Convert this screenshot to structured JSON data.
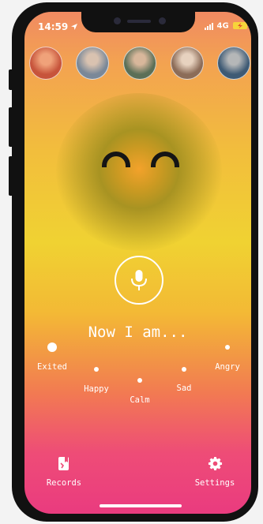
{
  "status_bar": {
    "time": "14:59",
    "network": "4G"
  },
  "friends": [
    {
      "name": "friend-1",
      "colors": [
        "#c7543b",
        "#f0a27a"
      ]
    },
    {
      "name": "friend-2",
      "colors": [
        "#7a8898",
        "#d9c2b0"
      ]
    },
    {
      "name": "friend-3",
      "colors": [
        "#5b6f57",
        "#d8b79b"
      ]
    },
    {
      "name": "friend-4",
      "colors": [
        "#8c6c58",
        "#e7d2bf"
      ]
    },
    {
      "name": "friend-5",
      "colors": [
        "#3e5a74",
        "#b5b7b8"
      ]
    }
  ],
  "prompt": "Now I am...",
  "moods": [
    {
      "label": "Exited",
      "selected": true
    },
    {
      "label": "Happy",
      "selected": false
    },
    {
      "label": "Calm",
      "selected": false
    },
    {
      "label": "Sad",
      "selected": false
    },
    {
      "label": "Angry",
      "selected": false
    }
  ],
  "nav": {
    "records": "Records",
    "settings": "Settings"
  },
  "colors": {
    "accent": "#ffffff",
    "gradient_top": "#f08a62",
    "gradient_mid": "#f0d232",
    "gradient_bottom": "#ea3b7f"
  }
}
